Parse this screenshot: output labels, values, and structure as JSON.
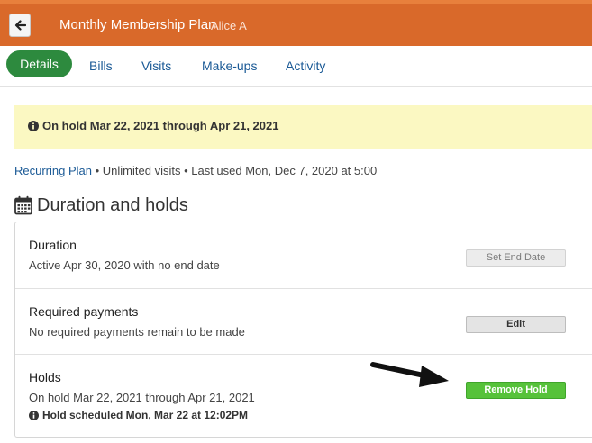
{
  "header": {
    "title": "Monthly Membership Plan",
    "user": "Alice A",
    "back_icon": "arrow-left-icon"
  },
  "tabs": [
    {
      "label": "Details",
      "active": true
    },
    {
      "label": "Bills",
      "active": false
    },
    {
      "label": "Visits",
      "active": false
    },
    {
      "label": "Make-ups",
      "active": false
    },
    {
      "label": "Activity",
      "active": false
    }
  ],
  "alert": {
    "icon": "info-circle-icon",
    "text": "On hold Mar 22, 2021 through Apr 21, 2021"
  },
  "meta": {
    "plan_link": "Recurring Plan",
    "details": " • Unlimited visits • Last used Mon, Dec 7, 2020 at 5:00"
  },
  "section": {
    "icon": "calendar-icon",
    "title": "Duration and holds"
  },
  "rows": {
    "duration": {
      "title": "Duration",
      "subtitle": "Active Apr 30, 2020 with no end date",
      "button": "Set End Date"
    },
    "payments": {
      "title": "Required payments",
      "subtitle": "No required payments remain to be made",
      "button": "Edit"
    },
    "holds": {
      "title": "Holds",
      "subtitle": "On hold Mar 22, 2021 through Apr 21, 2021",
      "note": "Hold scheduled Mon, Mar 22 at 12:02PM",
      "button": "Remove Hold"
    }
  },
  "colors": {
    "header": "#d9692a",
    "active_tab": "#2d8a3e",
    "link": "#1b5a96",
    "alert_bg": "#fbf8c2",
    "remove_hold": "#56c23a"
  }
}
